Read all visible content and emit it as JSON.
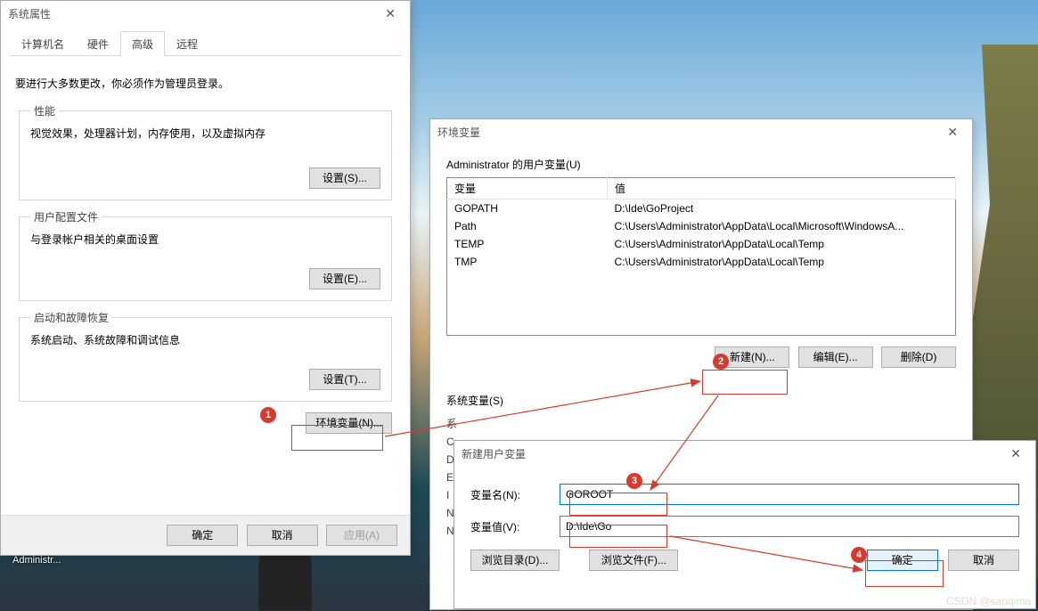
{
  "desktop": {
    "admin_label": "Administr..."
  },
  "sysprops": {
    "title": "系统属性",
    "tabs": {
      "computer_name": "计算机名",
      "hardware": "硬件",
      "advanced": "高级",
      "remote": "远程"
    },
    "admin_notice": "要进行大多数更改，你必须作为管理员登录。",
    "perf": {
      "legend": "性能",
      "desc": "视觉效果，处理器计划，内存使用，以及虚拟内存",
      "settings_btn": "设置(S)..."
    },
    "profiles": {
      "legend": "用户配置文件",
      "desc": "与登录帐户相关的桌面设置",
      "settings_btn": "设置(E)..."
    },
    "startup": {
      "legend": "启动和故障恢复",
      "desc": "系统启动、系统故障和调试信息",
      "settings_btn": "设置(T)..."
    },
    "envvar_btn": "环境变量(N)...",
    "ok": "确定",
    "cancel": "取消",
    "apply": "应用(A)"
  },
  "envdlg": {
    "title": "环境变量",
    "user_section": "Administrator 的用户变量(U)",
    "sys_section": "系统变量(S)",
    "col_var": "变量",
    "col_val": "值",
    "user_vars": [
      {
        "name": "GOPATH",
        "value": "D:\\Ide\\GoProject"
      },
      {
        "name": "Path",
        "value": "C:\\Users\\Administrator\\AppData\\Local\\Microsoft\\WindowsA..."
      },
      {
        "name": "TEMP",
        "value": "C:\\Users\\Administrator\\AppData\\Local\\Temp"
      },
      {
        "name": "TMP",
        "value": "C:\\Users\\Administrator\\AppData\\Local\\Temp"
      }
    ],
    "sys_vars_partial": [
      {
        "name": "系"
      },
      {
        "name": "C"
      },
      {
        "name": "D"
      },
      {
        "name": "E"
      },
      {
        "name": "I"
      },
      {
        "name": "N"
      },
      {
        "name": "N"
      }
    ],
    "new_btn": "新建(N)...",
    "edit_btn": "编辑(E)...",
    "del_btn": "删除(D)"
  },
  "newvardlg": {
    "title": "新建用户变量",
    "name_label": "变量名(N):",
    "name_value": "GOROOT",
    "value_label": "变量值(V):",
    "value_value": "D:\\Ide\\Go",
    "browse_dir": "浏览目录(D)...",
    "browse_file": "浏览文件(F)...",
    "ok": "确定",
    "cancel": "取消"
  },
  "annotations": {
    "b1": "1",
    "b2": "2",
    "b3": "3",
    "b4": "4"
  },
  "watermark": "CSDN @sanqima"
}
